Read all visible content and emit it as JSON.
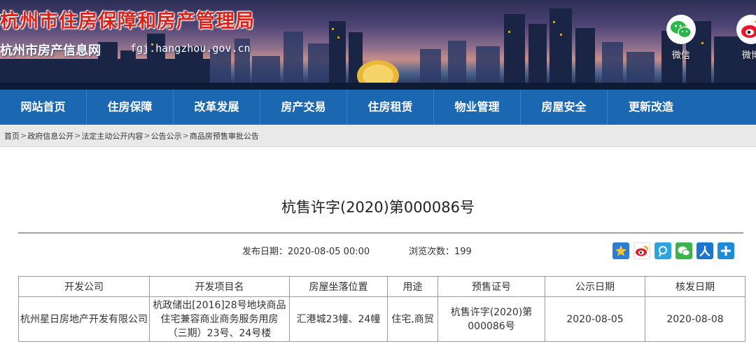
{
  "header": {
    "site_title": "杭州市住房保障和房产管理局",
    "sub_title": "杭州市房产信息网",
    "url": "fgj.hangzhou.gov.cn",
    "social": [
      {
        "label": "微信",
        "icon": "wechat-icon"
      },
      {
        "label": "微博",
        "icon": "weibo-icon"
      }
    ]
  },
  "nav": {
    "items": [
      "网站首页",
      "住房保障",
      "改革发展",
      "房产交易",
      "住房租赁",
      "物业管理",
      "房屋安全",
      "更新改造"
    ]
  },
  "breadcrumb": {
    "items": [
      "首页",
      "政府信息公开",
      "法定主动公开内容",
      "公告公示",
      "商品房预售审批公告"
    ],
    "separator": ">"
  },
  "article": {
    "title": "杭售许字(2020)第000086号",
    "publish_label": "发布日期：2020-08-05 00:00",
    "views_label": "浏览次数：199"
  },
  "share": {
    "icons": [
      "qzone-icon",
      "weibo-icon",
      "tencent-weibo-icon",
      "wechat-icon",
      "renren-icon",
      "more-icon"
    ],
    "colors": [
      "#2a7fd4",
      "#e6162d",
      "#2aa5e0",
      "#39b54a",
      "#1d76c9",
      "#1f8ad8"
    ]
  },
  "table": {
    "headers": [
      "开发公司",
      "开发项目名",
      "房屋坐落位置",
      "用途",
      "预售证号",
      "公示日期",
      "核发日期"
    ],
    "rows": [
      [
        "杭州星日房地产开发有限公司",
        "杭政储出[2016]28号地块商品住宅兼容商业商务服务用房（三期）23号、24号楼",
        "汇港城23幢、24幢",
        "住宅,商贸",
        "杭售许字(2020)第000086号",
        "2020-08-05",
        "2020-08-08"
      ]
    ]
  },
  "colors": {
    "nav_bg": "#1b67b2",
    "title_red": "#d8231b",
    "crumb_bg": "#e9e9e9"
  }
}
